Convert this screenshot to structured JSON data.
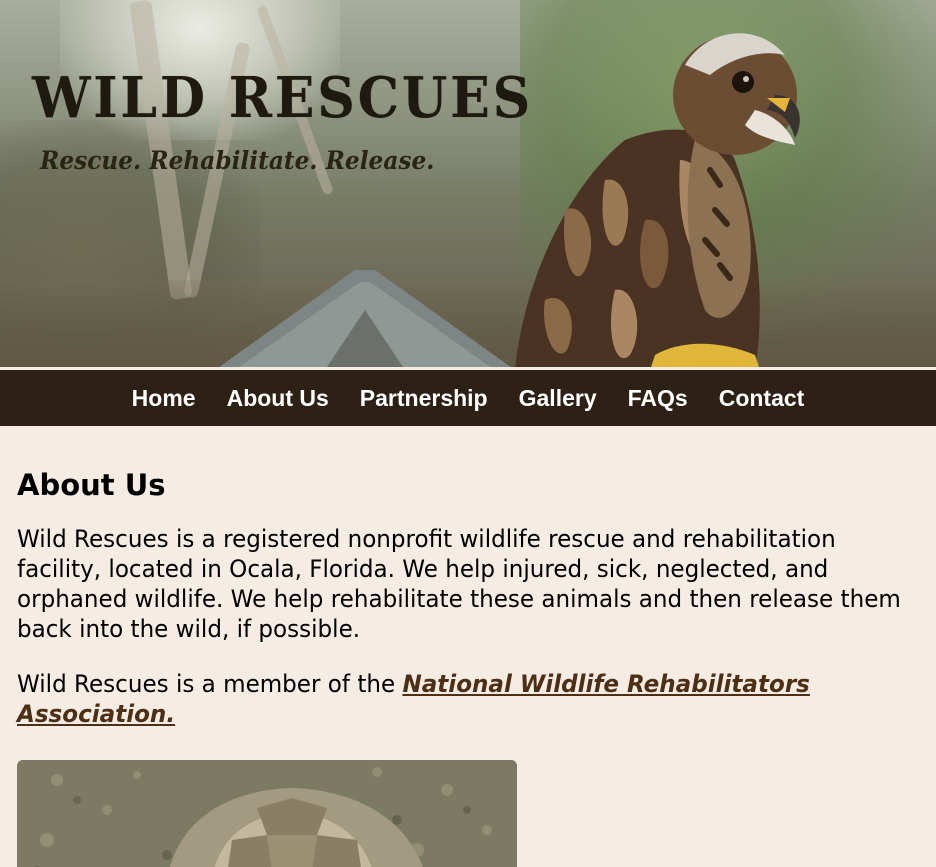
{
  "banner": {
    "title": "WILD RESCUES",
    "tagline": "Rescue. Rehabilitate. Release."
  },
  "nav": {
    "items": [
      "Home",
      "About Us",
      "Partnership",
      "Gallery",
      "FAQs",
      "Contact"
    ]
  },
  "main": {
    "heading": "About Us",
    "intro": "Wild Rescues is a registered nonprofit wildlife rescue and rehabilitation facility, located in Ocala, Florida. We help injured, sick, neglected, and orphaned wildlife. We help rehabilitate these animals and then release them back into the wild, if possible.",
    "membership_prefix": "Wild Rescues is a member of the ",
    "membership_link": "National Wildlife Rehabilitators Association."
  },
  "colors": {
    "page_background": "#f5ece4",
    "nav_background": "#2d2014",
    "nav_text": "#ffffff",
    "link": "#4d2f16"
  },
  "icons": {
    "banner_image": "hawk-photo",
    "content_image": "tortoise-photo"
  }
}
